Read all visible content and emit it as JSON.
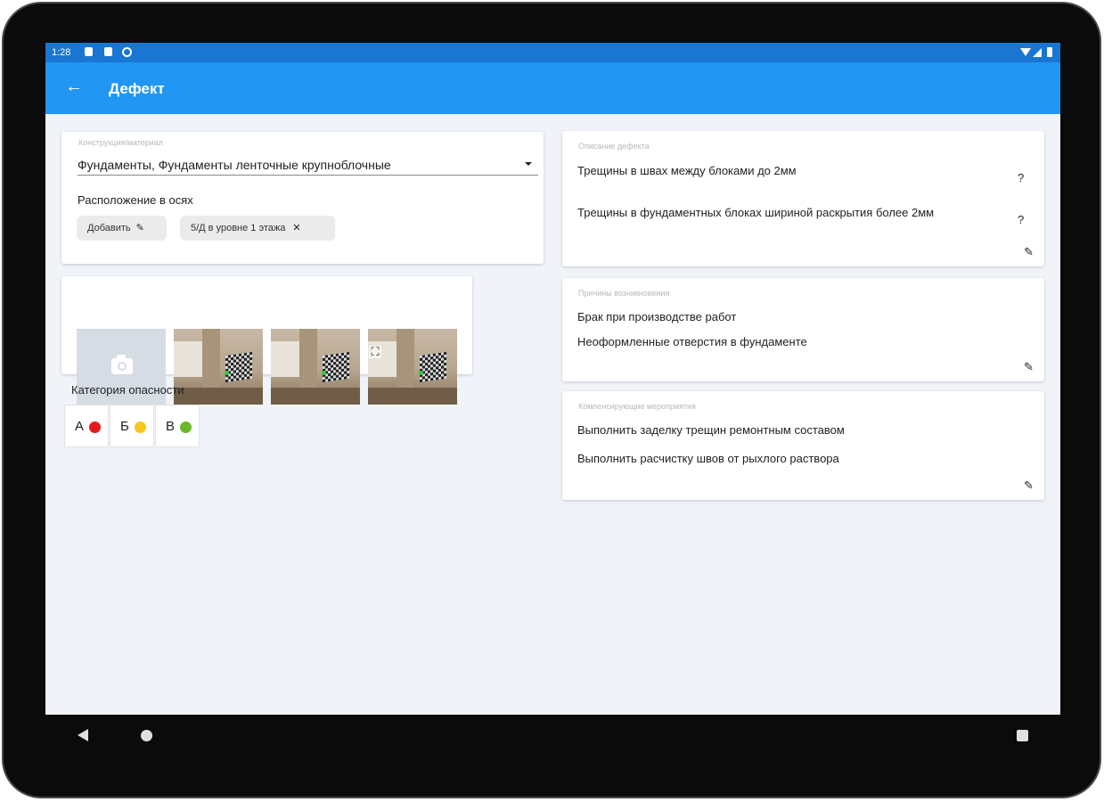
{
  "status_bar": {
    "time": "1:28"
  },
  "app_bar": {
    "title": "Дефект"
  },
  "construction": {
    "label": "Конструкция/материал",
    "value": "Фундаменты, Фундаменты ленточные крупноблочные"
  },
  "axes": {
    "label": "Расположение в осях",
    "add_chip": "Добавить",
    "location_chip": "5/Д в уровне 1 этажа"
  },
  "photos": {
    "count": 3
  },
  "danger": {
    "title": "Категория опасности",
    "categories": [
      {
        "letter": "А",
        "color": "#e31b1b"
      },
      {
        "letter": "Б",
        "color": "#f6c81d"
      },
      {
        "letter": "В",
        "color": "#6ab82a"
      }
    ]
  },
  "defect_description": {
    "label": "Описание дефекта",
    "items": [
      "Трещины в швах между блоками до 2мм",
      "Трещины в фундаментных блоках шириной раскрытия более 2мм"
    ],
    "help_symbol": "?"
  },
  "causes": {
    "label": "Причины возникновения",
    "items": [
      "Брак при производстве работ",
      "Неоформленные отверстия в фундаменте"
    ]
  },
  "compensating": {
    "label": "Компенсирующие мероприятия",
    "items": [
      "Выполнить заделку трещин ремонтным составом",
      "Выполнить расчистку швов от рыхлого раствора"
    ]
  },
  "colors": {
    "primary": "#2196f3",
    "status_bar": "#1976d2",
    "background": "#f0f3f7"
  }
}
